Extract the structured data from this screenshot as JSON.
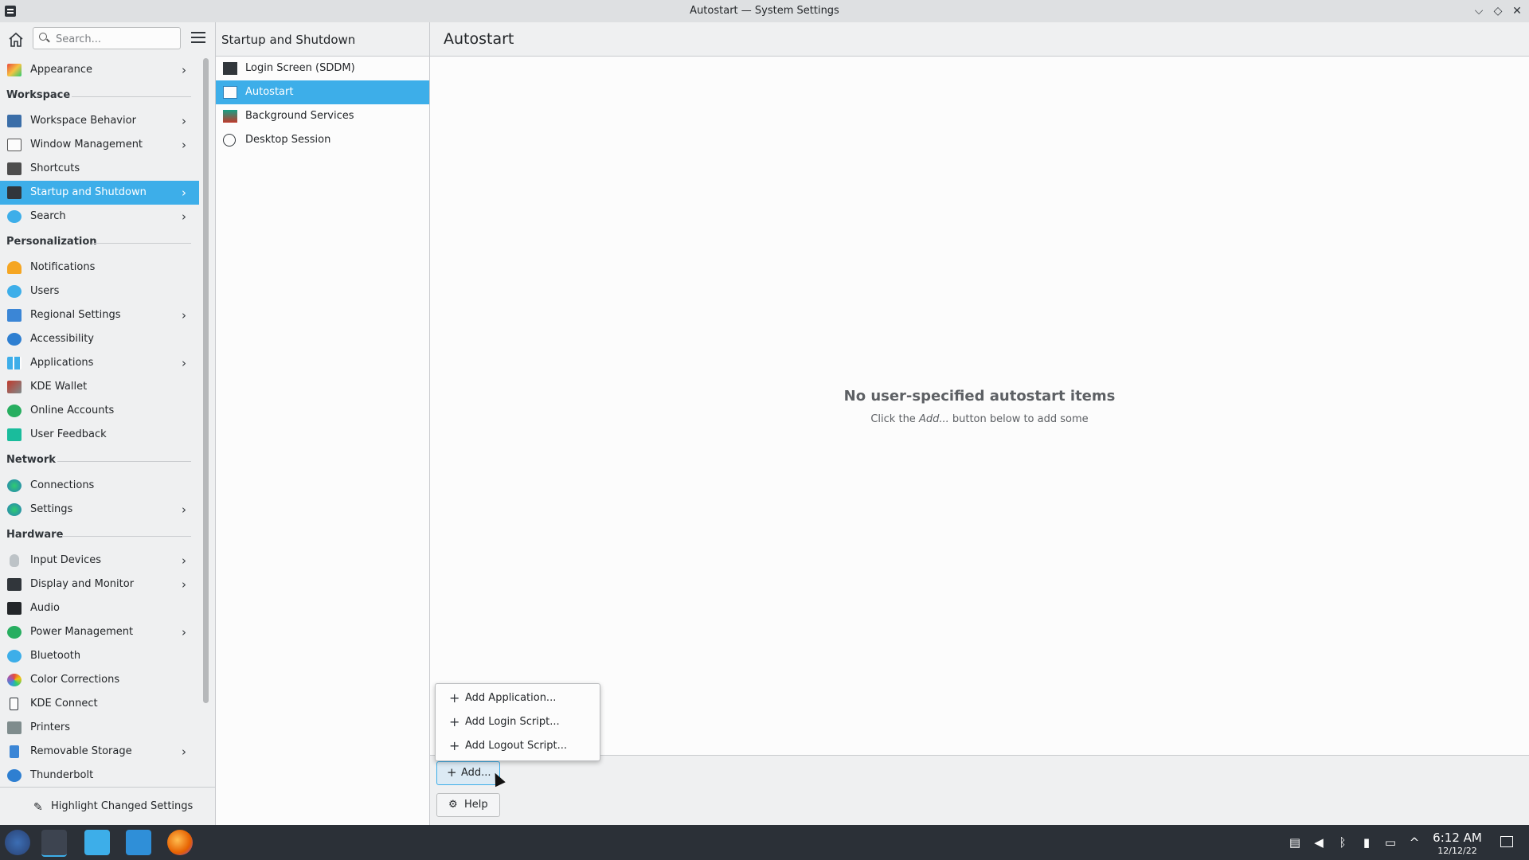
{
  "window": {
    "title": "Autostart — System Settings",
    "minimize_glyph": "⌵",
    "maximize_glyph": "◇",
    "close_glyph": "✕"
  },
  "search": {
    "placeholder": "Search..."
  },
  "sidebar": {
    "items": [
      {
        "label": "Appearance"
      },
      {
        "label": "Workspace Behavior"
      },
      {
        "label": "Window Management"
      },
      {
        "label": "Shortcuts"
      },
      {
        "label": "Startup and Shutdown"
      },
      {
        "label": "Search"
      },
      {
        "label": "Notifications"
      },
      {
        "label": "Users"
      },
      {
        "label": "Regional Settings"
      },
      {
        "label": "Accessibility"
      },
      {
        "label": "Applications"
      },
      {
        "label": "KDE Wallet"
      },
      {
        "label": "Online Accounts"
      },
      {
        "label": "User Feedback"
      },
      {
        "label": "Connections"
      },
      {
        "label": "Settings"
      },
      {
        "label": "Input Devices"
      },
      {
        "label": "Display and Monitor"
      },
      {
        "label": "Audio"
      },
      {
        "label": "Power Management"
      },
      {
        "label": "Bluetooth"
      },
      {
        "label": "Color Corrections"
      },
      {
        "label": "KDE Connect"
      },
      {
        "label": "Printers"
      },
      {
        "label": "Removable Storage"
      },
      {
        "label": "Thunderbolt"
      }
    ],
    "sections": {
      "workspace": "Workspace",
      "personalization": "Personalization",
      "network": "Network",
      "hardware": "Hardware"
    },
    "chevron": "›",
    "highlight_label": "Highlight Changed Settings"
  },
  "subpane": {
    "title": "Startup and Shutdown",
    "items": [
      {
        "label": "Login Screen (SDDM)"
      },
      {
        "label": "Autostart"
      },
      {
        "label": "Background Services"
      },
      {
        "label": "Desktop Session"
      }
    ]
  },
  "content": {
    "title": "Autostart",
    "empty_title": "No user-specified autostart items",
    "empty_sub_prefix": "Click the ",
    "empty_sub_em": "Add...",
    "empty_sub_suffix": " button below to add some",
    "add_label": "Add...",
    "help_label": "Help",
    "plus_glyph": "+"
  },
  "popup": {
    "items": [
      {
        "label": "Add Application..."
      },
      {
        "label": "Add Login Script..."
      },
      {
        "label": "Add Logout Script..."
      }
    ]
  },
  "taskbar": {
    "time": "6:12 AM",
    "date": "12/12/22"
  },
  "colors": {
    "accent": "#3daee9",
    "taskbar": "#2b3037",
    "window_bg": "#eff0f1"
  }
}
